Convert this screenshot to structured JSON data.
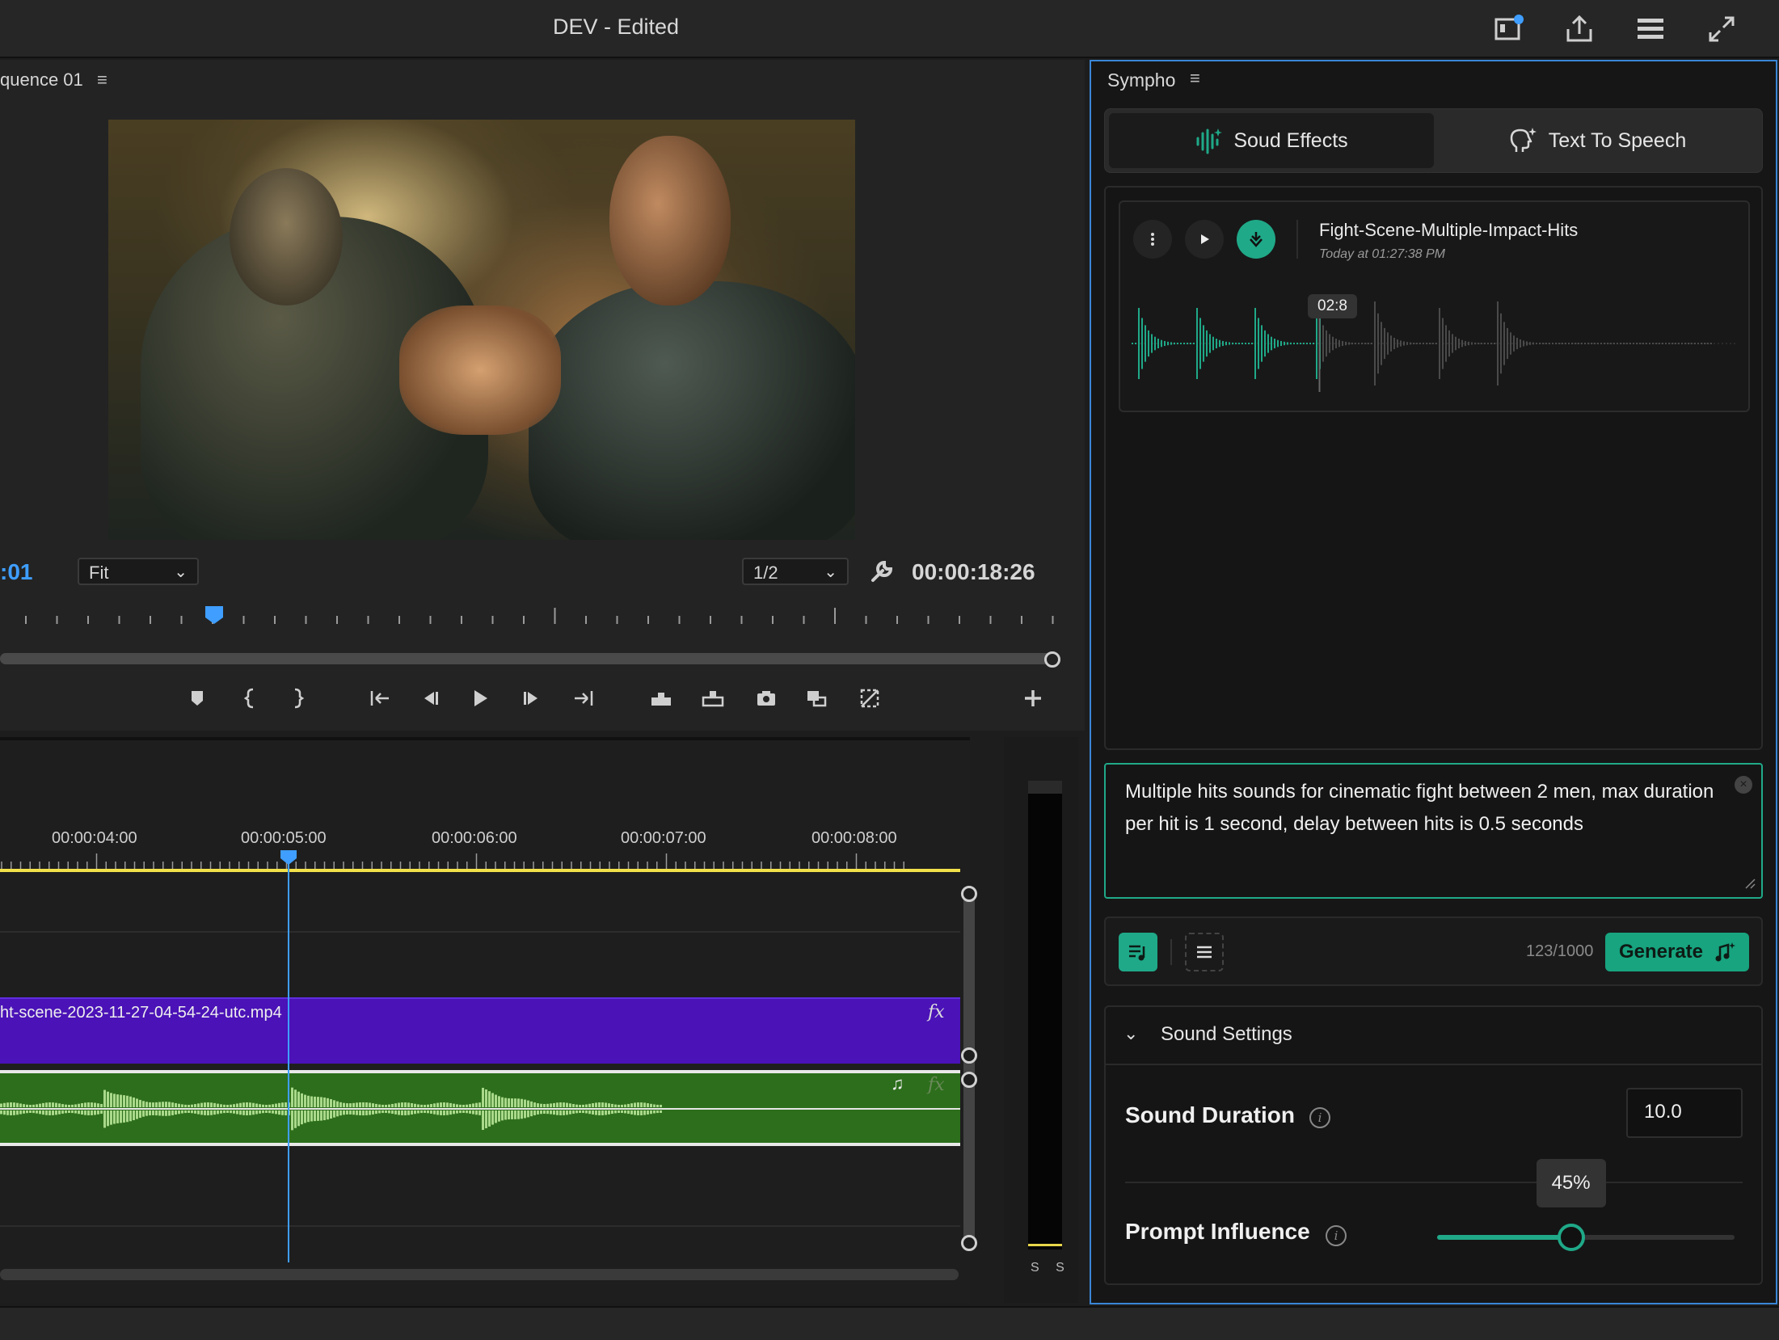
{
  "app": {
    "title": "DEV - Edited"
  },
  "monitor": {
    "sequence_tab": "quence 01",
    "current_time": ":01",
    "fit_select": "Fit",
    "resolution_select": "1/2",
    "duration_time": "00:00:18:26"
  },
  "timeline": {
    "timecodes": [
      "00:00:04:00",
      "00:00:05:00",
      "00:00:06:00",
      "00:00:07:00",
      "00:00:08:00"
    ],
    "video_clip_name": "ht-scene-2023-11-27-04-54-24-utc.mp4",
    "fx_label": "fx"
  },
  "meter": {
    "labels": "S S"
  },
  "panel": {
    "title": "Sympho",
    "tabs": [
      {
        "label": "Soud Effects",
        "icon": "waveform-sparkle-icon",
        "active": true
      },
      {
        "label": "Text To Speech",
        "icon": "speaking-head-sparkle-icon",
        "active": false
      }
    ],
    "result": {
      "title": "Fight-Scene-Multiple-Impact-Hits",
      "date": "Today at 01:27:38 PM",
      "tooltip": "02:8",
      "progress_fraction": 0.31
    },
    "prompt": {
      "text": "Multiple hits sounds for cinematic fight between 2 men, max duration per hit is 1 second, delay between hits is 0.5 seconds"
    },
    "char_count": "123/1000",
    "generate_label": "Generate",
    "settings": {
      "title": "Sound Settings",
      "duration_label": "Sound Duration",
      "duration_value": "10.0",
      "prompt_influence_label": "Prompt Influence",
      "prompt_influence_display": "45%",
      "prompt_influence_value": 0.45
    }
  },
  "colors": {
    "accent": "#1fa988",
    "timecode_blue": "#3f9eff",
    "video_clip": "#4a12b7",
    "audio_clip": "#2d6e1c",
    "panel_border": "#3a86d6"
  }
}
